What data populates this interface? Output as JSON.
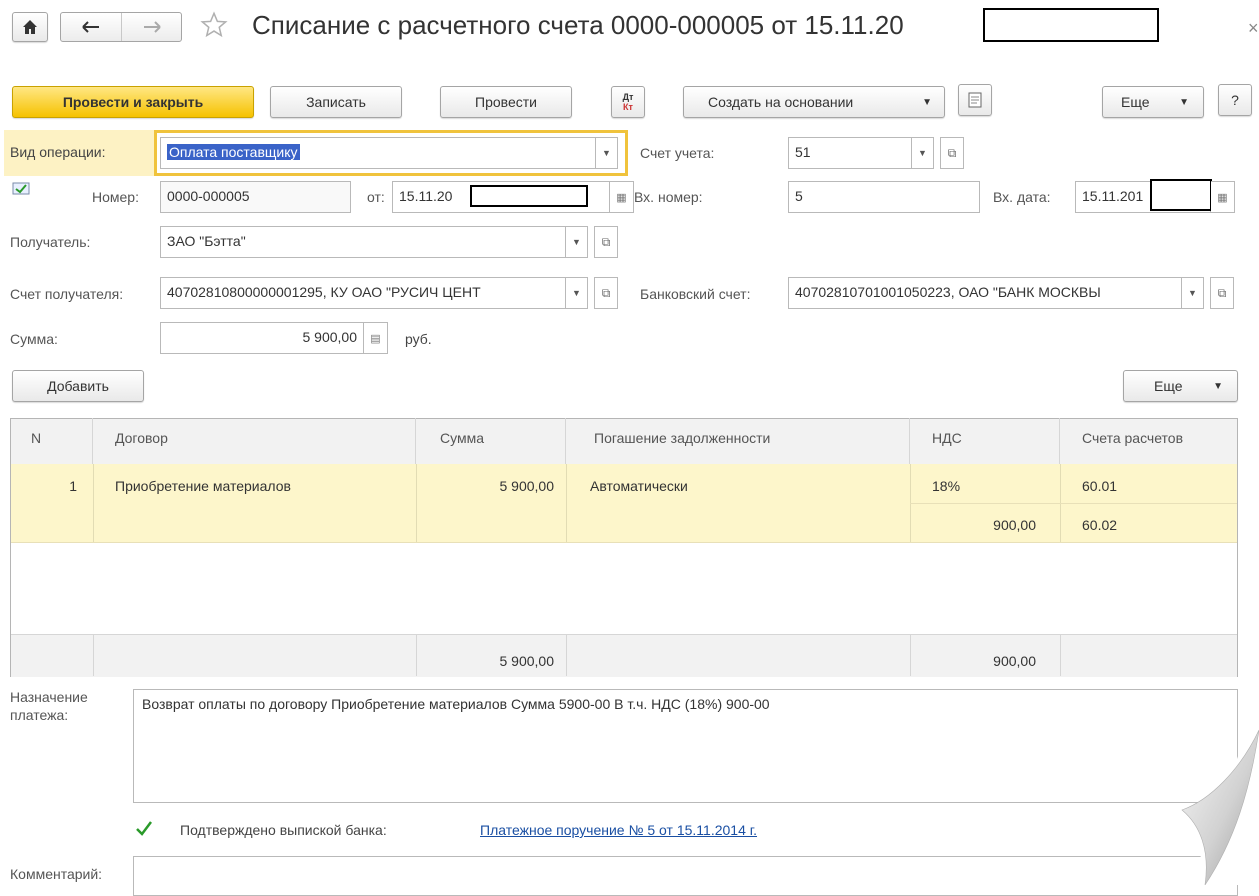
{
  "header": {
    "title": "Списание с расчетного счета 0000-000005 от 15.11.20",
    "close_glyph": "×"
  },
  "toolbar": {
    "post_close": "Провести и закрыть",
    "save": "Записать",
    "post": "Провести",
    "dt_kt_top": "Дт",
    "dt_kt_bottom": "Кт",
    "create_based": "Создать на основании",
    "more": "Еще",
    "help": "?"
  },
  "form": {
    "operation_label": "Вид операции:",
    "operation_value": "Оплата поставщику",
    "account_label": "Счет учета:",
    "account_value": "51",
    "number_label": "Номер:",
    "number_value": "0000-000005",
    "from_label": "от:",
    "from_value": "15.11.20",
    "in_number_label": "Вх. номер:",
    "in_number_value": "5",
    "in_date_label": "Вх. дата:",
    "in_date_value": "15.11.201",
    "recipient_label": "Получатель:",
    "recipient_value": "ЗАО \"Бэтта\"",
    "recipient_account_label": "Счет получателя:",
    "recipient_account_value": "40702810800000001295, КУ ОАО \"РУСИЧ ЦЕНТ",
    "bank_account_label": "Банковский счет:",
    "bank_account_value": "40702810701001050223, ОАО \"БАНК МОСКВЫ",
    "sum_label": "Сумма:",
    "sum_value": "5 900,00",
    "currency": "руб."
  },
  "table_toolbar": {
    "add": "Добавить",
    "more": "Еще"
  },
  "table": {
    "headers": [
      "N",
      "Договор",
      "Сумма",
      "Погашение задолженности",
      "НДС",
      "Счета расчетов"
    ],
    "row": {
      "n": "1",
      "contract": "Приобретение материалов",
      "sum": "5 900,00",
      "repayment": "Автоматически",
      "vat_rate": "18%",
      "vat_amount": "900,00",
      "account1": "60.01",
      "account2": "60.02"
    },
    "footer": {
      "sum": "5 900,00",
      "vat": "900,00"
    }
  },
  "purpose": {
    "label_line1": "Назначение",
    "label_line2": "платежа:",
    "text": "Возврат оплаты по договору Приобретение материалов Сумма 5900-00 В т.ч. НДС  (18%) 900-00"
  },
  "confirm": {
    "label": "Подтверждено выпиской банка:",
    "link": "Платежное поручение № 5 от 15.11.2014 г."
  },
  "comment": {
    "label": "Комментарий:"
  },
  "colors": {
    "primary_button": "#f6c200",
    "selected_row": "#fdf6cb",
    "link": "#1a4fa3",
    "focus_border": "#f0c33c"
  }
}
